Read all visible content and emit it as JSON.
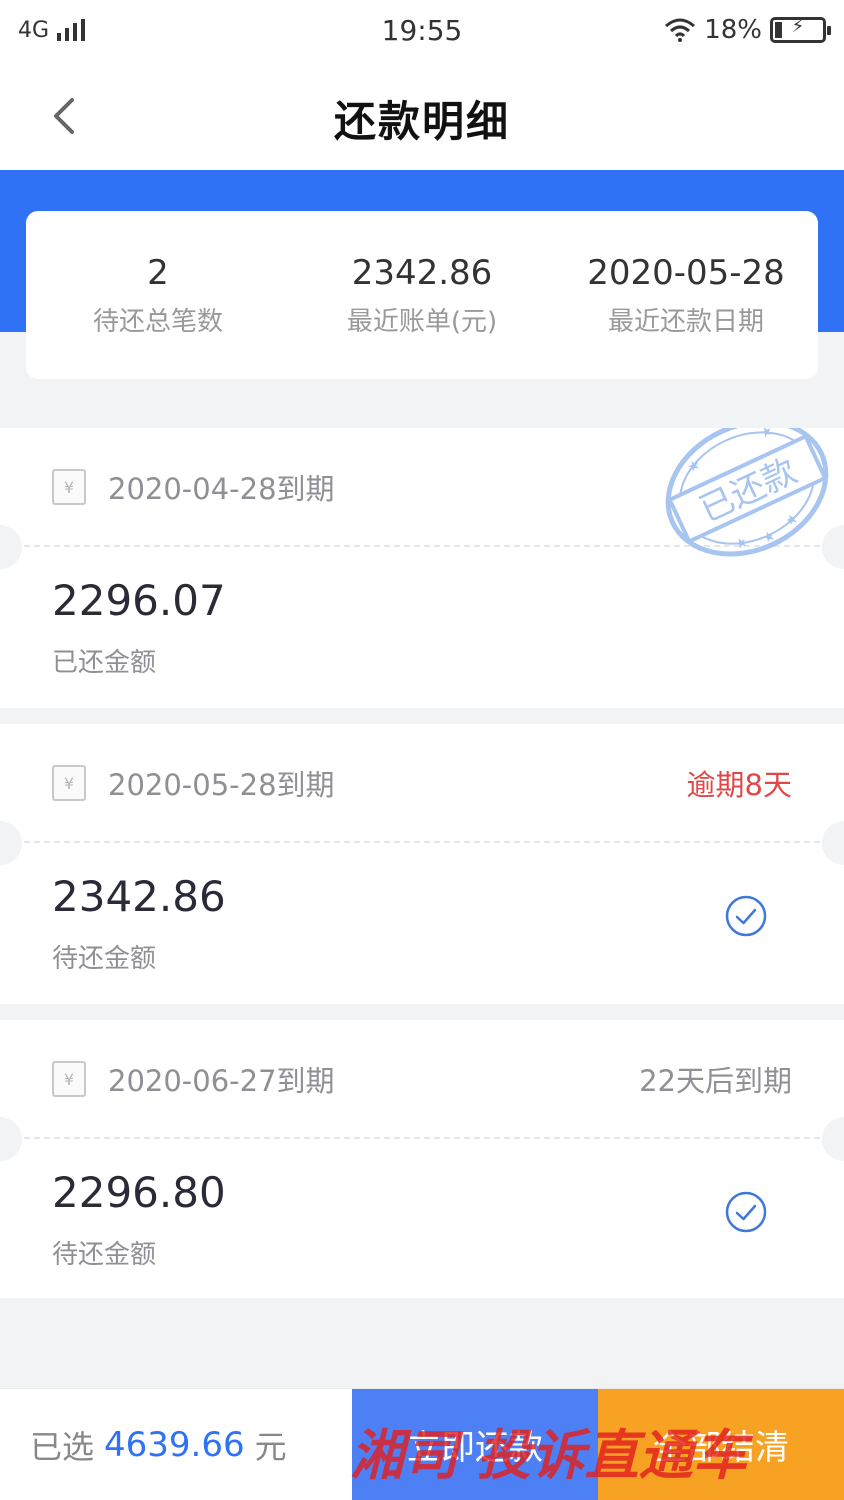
{
  "status_bar": {
    "network": "4G",
    "time": "19:55",
    "battery": "18%"
  },
  "nav": {
    "title": "还款明细"
  },
  "summary": {
    "total_count_value": "2",
    "total_count_label": "待还总笔数",
    "recent_bill_value": "2342.86",
    "recent_bill_label": "最近账单(元)",
    "recent_date_value": "2020-05-28",
    "recent_date_label": "最近还款日期"
  },
  "bills": [
    {
      "icon_symbol": "¥",
      "due": "2020-04-28到期",
      "status": "",
      "amount": "2296.07",
      "amount_label": "已还金额",
      "stamp": "已还款"
    },
    {
      "icon_symbol": "¥",
      "due": "2020-05-28到期",
      "status": "逾期8天",
      "amount": "2342.86",
      "amount_label": "待还金额"
    },
    {
      "icon_symbol": "¥",
      "due": "2020-06-27到期",
      "status": "22天后到期",
      "amount": "2296.80",
      "amount_label": "待还金额"
    }
  ],
  "bottom": {
    "selected_prefix": "已选",
    "selected_amount": "4639.66",
    "selected_unit": "元",
    "pay_now": "立即还款",
    "settle_all": "全部结清"
  },
  "watermark": "湘司 投诉直通车",
  "colors": {
    "accent_blue": "#2f72f5",
    "overdue_red": "#e04848",
    "settle_orange": "#f7a223"
  },
  "icons": {
    "back": "chevron-left-icon",
    "receipt": "receipt-icon",
    "check": "check-circle-icon",
    "stamp": "paid-stamp-icon"
  }
}
